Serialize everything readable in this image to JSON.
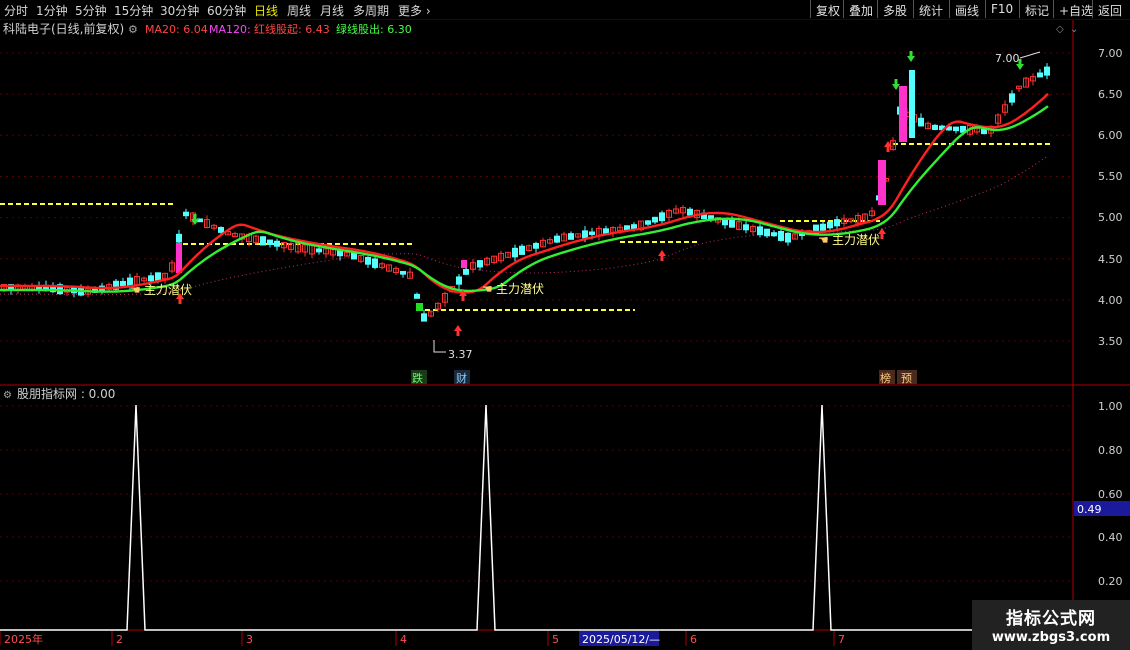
{
  "toolbar": {
    "timeframes": [
      "分时",
      "1分钟",
      "5分钟",
      "15分钟",
      "30分钟",
      "60分钟",
      "日线",
      "周线",
      "月线",
      "多周期",
      "更多"
    ],
    "active": "日线",
    "right_buttons": [
      "复权",
      "叠加",
      "多股",
      "统计",
      "画线",
      "F10",
      "标记",
      "+自选",
      "返回"
    ]
  },
  "main_panel": {
    "title": "科陆电子(日线,前复权)",
    "indicators": [
      {
        "label": "MA20: 6.04",
        "color": "#ff4444"
      },
      {
        "label": "MA120:",
        "color": "#ff44ff"
      },
      {
        "label": "红线股起: 6.43",
        "color": "#ff4444"
      },
      {
        "label": "绿线股出: 6.30",
        "color": "#44ff44"
      }
    ],
    "price_axis": [
      "7.00",
      "6.50",
      "6.00",
      "5.50",
      "5.00",
      "4.50",
      "4.00",
      "3.50"
    ],
    "annotations": {
      "high_label": "7.00",
      "low_label": "3.37",
      "signal_label": "主力潜伏",
      "markers": [
        "跌",
        "财",
        "榜",
        "预"
      ]
    }
  },
  "sub_panel": {
    "title": "股朋指标网 : 0.00",
    "axis": [
      "1.00",
      "0.80",
      "0.60",
      "0.40",
      "0.20"
    ],
    "current_value": "0.49"
  },
  "date_axis": {
    "labels": [
      "2025年",
      "2",
      "3",
      "4",
      "5",
      "6",
      "7"
    ],
    "cursor_date": "2025/05/12/—"
  },
  "watermark": {
    "line1": "指标公式网",
    "line2": "www.zbgs3.com"
  },
  "colors": {
    "up": "#ff3232",
    "down": "#54ffff",
    "ma_red": "#ff2020",
    "ma_green": "#33ee33",
    "magenta": "#ff33cc",
    "dashed": "#ffff33"
  }
}
